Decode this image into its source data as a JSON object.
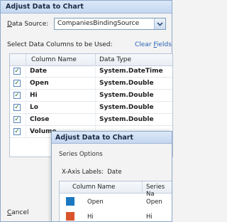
{
  "dialog": {
    "title": "Adjust Data to Chart",
    "data_source_label": "Data Source:",
    "data_source_value": "CompaniesBindingSource",
    "select_columns_label": "Select Data Columns to be Used:",
    "clear_fields_label": "Clear Fields",
    "cancel_label": "Cancel",
    "columns": {
      "name": "Column Name",
      "type": "Data Type"
    },
    "rows": [
      {
        "checked": true,
        "name": "Date",
        "type": "System.DateTime"
      },
      {
        "checked": true,
        "name": "Open",
        "type": "System.Double"
      },
      {
        "checked": true,
        "name": "Hi",
        "type": "System.Double"
      },
      {
        "checked": true,
        "name": "Lo",
        "type": "System.Double"
      },
      {
        "checked": true,
        "name": "Close",
        "type": "System.Double"
      },
      {
        "checked": true,
        "name": "Volume",
        "type": ""
      }
    ]
  },
  "series_dialog": {
    "title": "Adjust Data to Chart",
    "section_label": "Series Options",
    "x_axis_label": "X-Axis Labels:",
    "x_axis_value": "Date",
    "columns": {
      "name": "Column Name",
      "series": "Series Na"
    },
    "rows": [
      {
        "color": "#1a78c2",
        "name": "Open",
        "series": "Open"
      },
      {
        "color": "#d9542b",
        "name": "Hi",
        "series": "Hi"
      }
    ]
  }
}
